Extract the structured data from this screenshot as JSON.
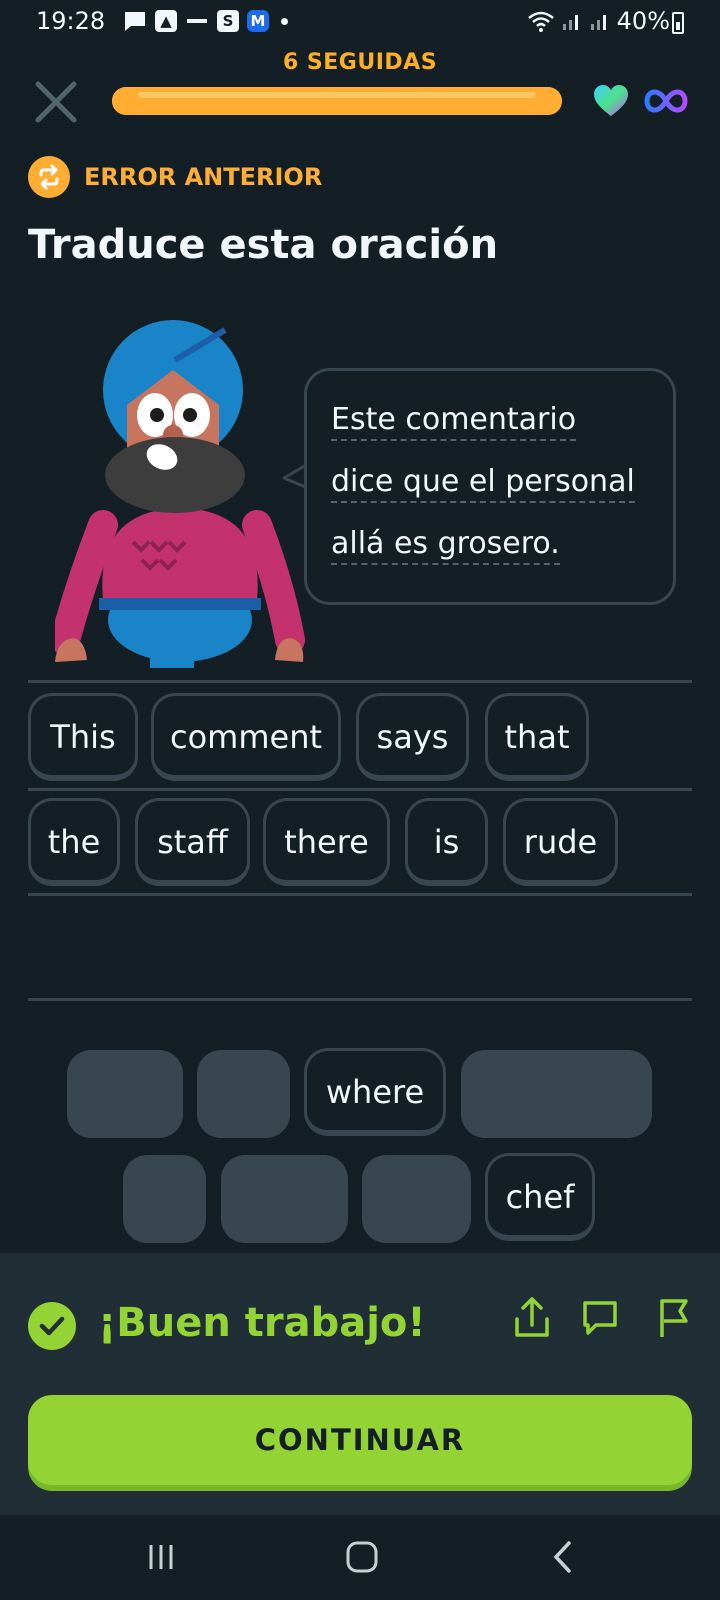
{
  "status_bar": {
    "time": "19:28",
    "battery": "40%"
  },
  "header": {
    "streak": "6 SEGUIDAS",
    "progress": 1.0,
    "lives": "infinity"
  },
  "lesson": {
    "previous_error_label": "ERROR ANTERIOR",
    "title": "Traduce esta oración",
    "prompt_lines": [
      "Este comentario",
      "dice que el personal",
      "allá es grosero."
    ]
  },
  "answer_words": [
    "This",
    "comment",
    "says",
    "that",
    "the",
    "staff",
    "there",
    "is",
    "rude"
  ],
  "word_bank": {
    "remaining": [
      "where",
      "chef"
    ]
  },
  "feedback": {
    "message": "¡Buen trabajo!",
    "continue_label": "CONTINUAR"
  },
  "colors": {
    "background": "#131f24",
    "accent_orange": "#ffae33",
    "success_green": "#93d333",
    "border": "#37464f"
  },
  "icons": {
    "close": "close-icon",
    "heart": "heart-icon",
    "infinity": "infinity-icon",
    "repeat": "repeat-icon",
    "check": "check-icon",
    "share": "share-icon",
    "comment": "comment-icon",
    "flag": "flag-icon"
  }
}
